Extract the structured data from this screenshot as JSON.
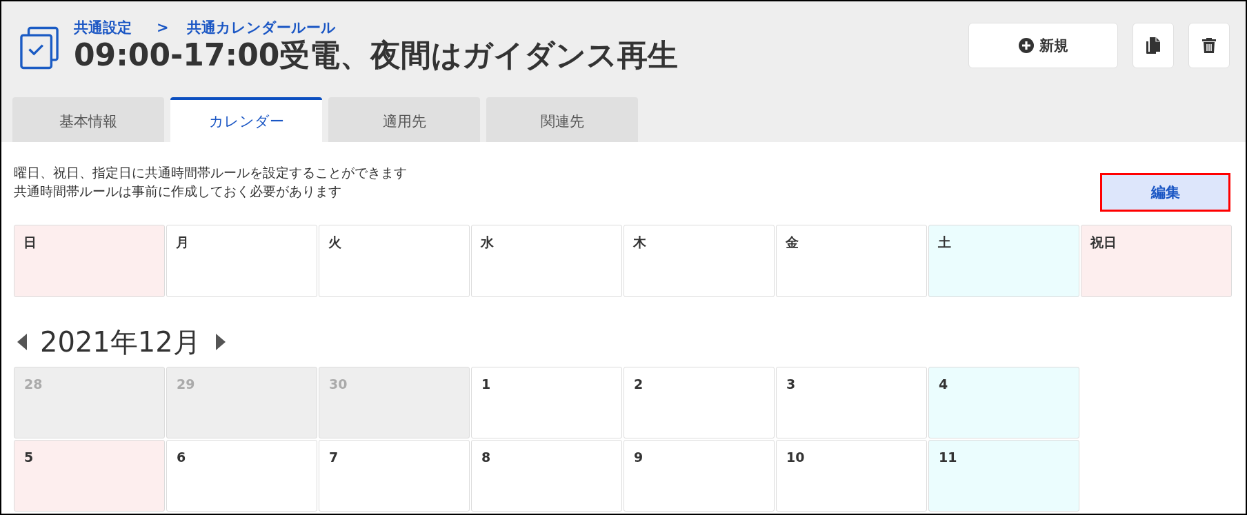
{
  "header": {
    "breadcrumb": {
      "items": [
        {
          "label": "共通設定"
        },
        {
          "label": "共通カレンダールール"
        }
      ],
      "separator": ">"
    },
    "title": "09:00-17:00受電、夜間はガイダンス再生",
    "actions": [
      {
        "kind": "add",
        "label": "新規"
      },
      {
        "kind": "copy"
      },
      {
        "kind": "delete"
      }
    ]
  },
  "tabs": [
    {
      "label": "基本情報",
      "selected": false
    },
    {
      "label": "カレンダー",
      "selected": true
    },
    {
      "label": "適用先",
      "selected": false
    },
    {
      "label": "関連先",
      "selected": false
    }
  ],
  "description": [
    "曜日、祝日、指定日に共通時間帯ルールを設定することができます",
    "共通時間帯ルールは事前に作成しておく必要があります"
  ],
  "edit_button": {
    "label": "編集",
    "highlighted": true
  },
  "weekday_rules": [
    {
      "label": "日",
      "kind": "sunday"
    },
    {
      "label": "月",
      "kind": "weekday"
    },
    {
      "label": "火",
      "kind": "weekday"
    },
    {
      "label": "水",
      "kind": "weekday"
    },
    {
      "label": "木",
      "kind": "weekday"
    },
    {
      "label": "金",
      "kind": "weekday"
    },
    {
      "label": "土",
      "kind": "saturday"
    },
    {
      "label": "祝日",
      "kind": "holiday"
    }
  ],
  "calendar": {
    "month": "2021年12月",
    "weeks": [
      {
        "days": [
          {
            "day": "28",
            "kind": "outside"
          },
          {
            "day": "29",
            "kind": "outside"
          },
          {
            "day": "30",
            "kind": "outside"
          },
          {
            "day": "1",
            "kind": "weekday"
          },
          {
            "day": "2",
            "kind": "weekday"
          },
          {
            "day": "3",
            "kind": "weekday"
          },
          {
            "day": "4",
            "kind": "saturday"
          }
        ]
      },
      {
        "days": [
          {
            "day": "5",
            "kind": "sunday"
          },
          {
            "day": "6",
            "kind": "weekday"
          },
          {
            "day": "7",
            "kind": "weekday"
          },
          {
            "day": "8",
            "kind": "weekday"
          },
          {
            "day": "9",
            "kind": "weekday"
          },
          {
            "day": "10",
            "kind": "weekday"
          },
          {
            "day": "11",
            "kind": "saturday"
          }
        ]
      }
    ]
  }
}
